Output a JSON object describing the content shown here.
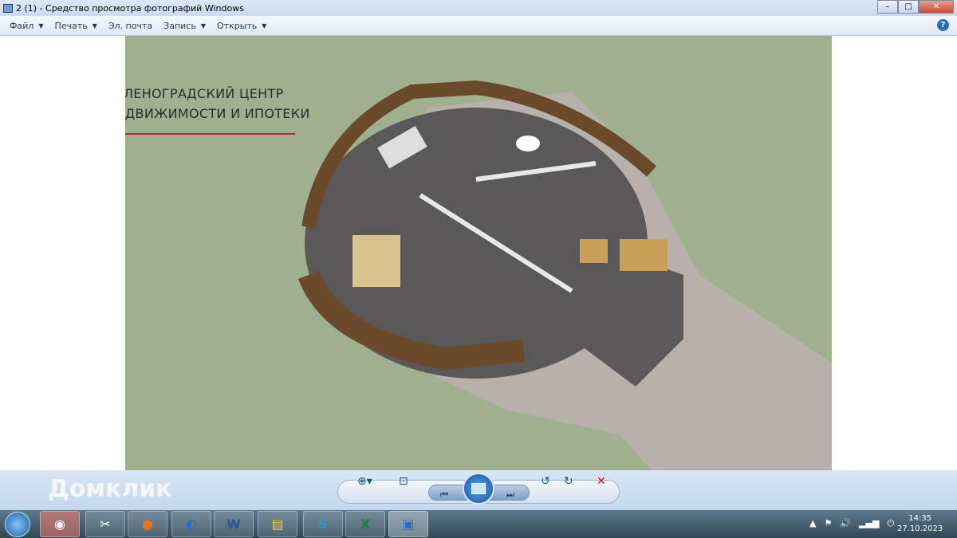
{
  "window": {
    "title": "2 (1) - Средство просмотра фотографий Windows",
    "minimize": "–",
    "maximize": "□",
    "close": "✕"
  },
  "menu": [
    {
      "label": "Файл"
    },
    {
      "label": "Печать"
    },
    {
      "label": "Эл. почта"
    },
    {
      "label": "Запись"
    },
    {
      "label": "Открыть"
    }
  ],
  "help_label": "?",
  "photo": {
    "logo_line1": "ЗЕЛЕНОГРАДСКИЙ ЦЕНТР",
    "logo_line2": "НЕДВИЖИМОСТИ И ИПОТЕКИ",
    "background_color": "#9fb08e",
    "logo_color": "#c0262c"
  },
  "watermark": "Домклик",
  "controls": {
    "zoom": "⊕▾",
    "fit": "⊡",
    "prev": "⏮",
    "next": "⏭",
    "rotate_ccw": "↺",
    "rotate_cw": "↻",
    "delete": "✕"
  },
  "taskbar": {
    "apps": [
      {
        "name": "chrome",
        "label": "◉"
      },
      {
        "name": "snipping",
        "label": "✂"
      },
      {
        "name": "firefox",
        "label": "●"
      },
      {
        "name": "thunderbird",
        "label": "◐"
      },
      {
        "name": "word",
        "label": "W"
      },
      {
        "name": "explorer",
        "label": "▤"
      },
      {
        "name": "skype",
        "label": "S"
      },
      {
        "name": "excel",
        "label": "X"
      },
      {
        "name": "photo-viewer",
        "label": "▣"
      }
    ],
    "tray": {
      "arrow": "▲",
      "flag": "⚑",
      "volume": "🔊",
      "signal": "▂▄▆",
      "power": "⏻"
    },
    "time": "14:35",
    "date": "27.10.2023"
  }
}
